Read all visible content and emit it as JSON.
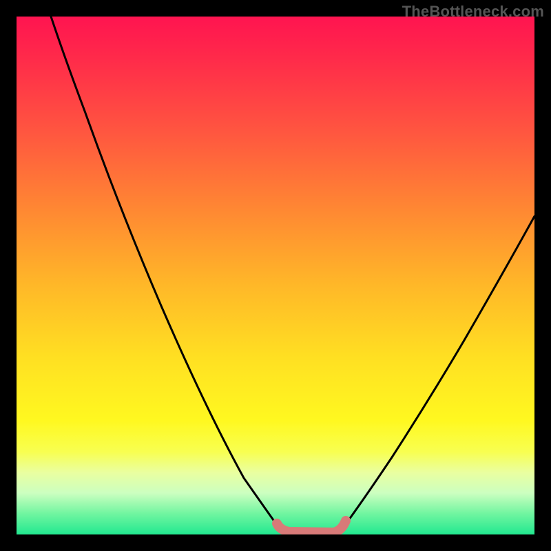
{
  "watermark": {
    "text": "TheBottleneck.com"
  },
  "chart_data": {
    "type": "line",
    "title": "",
    "xlabel": "",
    "ylabel": "",
    "xlim": [
      0,
      100
    ],
    "ylim": [
      0,
      100
    ],
    "series": [
      {
        "name": "curve-left",
        "x": [
          7,
          12,
          18,
          24,
          30,
          36,
          42,
          47,
          51
        ],
        "values": [
          100,
          85,
          70,
          56,
          42,
          29,
          16,
          6,
          0
        ]
      },
      {
        "name": "curve-right",
        "x": [
          62,
          66,
          72,
          78,
          84,
          90,
          96,
          100
        ],
        "values": [
          0,
          4,
          12,
          22,
          33,
          44,
          54,
          61
        ]
      },
      {
        "name": "trough-highlight",
        "x": [
          51,
          54,
          57,
          60,
          62
        ],
        "values": [
          0,
          0,
          0,
          0,
          0
        ]
      }
    ],
    "colors": {
      "curve": "#000000",
      "trough": "#d87a78",
      "gradient_top": "#ff1450",
      "gradient_bottom": "#22e890"
    }
  }
}
